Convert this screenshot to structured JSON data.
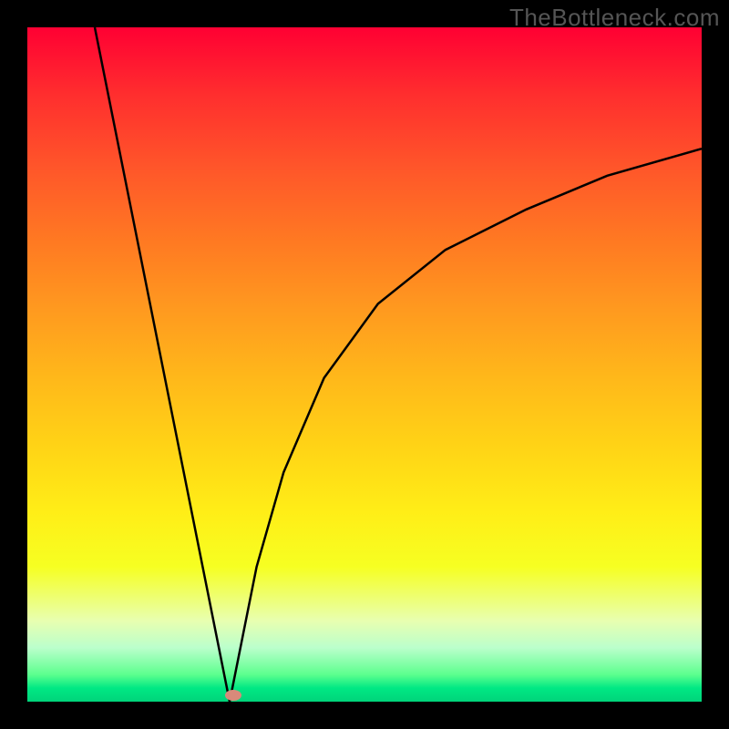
{
  "watermark": "TheBottleneck.com",
  "frame": {
    "border_color": "#000000"
  },
  "gradient_stops": [
    {
      "pct": 0,
      "color": "#ff0033"
    },
    {
      "pct": 50,
      "color": "#ffb81a"
    },
    {
      "pct": 80,
      "color": "#f6ff22"
    },
    {
      "pct": 100,
      "color": "#00d47a"
    }
  ],
  "marker": {
    "x_pct": 30.5,
    "y_pct": 99.0,
    "color": "#d88a7a"
  },
  "chart_data": {
    "type": "line",
    "title": "",
    "xlabel": "",
    "ylabel": "",
    "xlim": [
      0,
      100
    ],
    "ylim": [
      0,
      100
    ],
    "description": "V-shaped curve with sharp minimum near x≈30, steep near-linear left branch from (10,100) to (30,0), and concave asymptotic right branch rising toward ~82 at x=100. Background heat gradient from red (top) to green (bottom).",
    "series": [
      {
        "name": "curve",
        "x": [
          10,
          14,
          18,
          22,
          26,
          28,
          30,
          32,
          34,
          38,
          44,
          52,
          62,
          74,
          86,
          100
        ],
        "y": [
          100,
          80,
          60,
          40,
          20,
          10,
          0,
          10,
          20,
          34,
          48,
          59,
          67,
          73,
          78,
          82
        ]
      }
    ],
    "marker_point": {
      "x": 30.5,
      "y": 1
    }
  }
}
